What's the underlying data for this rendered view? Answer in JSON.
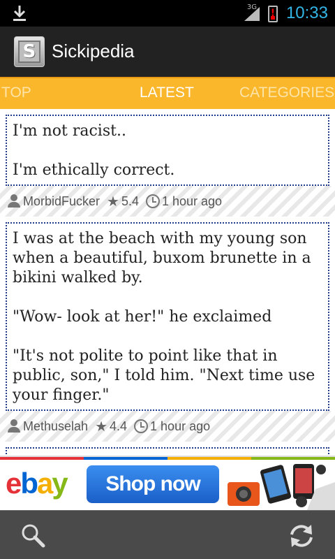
{
  "status_bar": {
    "network": "3G",
    "time": "10:33",
    "battery_alert": "!"
  },
  "app": {
    "title": "Sickipedia",
    "logo_letter": "S"
  },
  "tabs": [
    {
      "label": "TOP",
      "selected": false
    },
    {
      "label": "LATEST",
      "selected": true
    },
    {
      "label": "CATEGORIES",
      "selected": false
    }
  ],
  "posts": [
    {
      "lines": [
        "I'm not racist..",
        "I'm ethically correct."
      ],
      "author": "MorbidFucker",
      "rating": "5.4",
      "time": "1 hour ago"
    },
    {
      "lines": [
        "I was at the beach with my young son when a beautiful, buxom brunette in a bikini walked by.",
        "\"Wow- look at her!\" he exclaimed",
        "\"It's not polite to point like that in public, son,\" I told him. \"Next time use your finger.\""
      ],
      "author": "Methuselah",
      "rating": "4.4",
      "time": "1 hour ago"
    }
  ],
  "ad": {
    "brand_e": "e",
    "brand_b": "b",
    "brand_a": "a",
    "brand_y": "y",
    "button": "Shop now"
  },
  "icons": {
    "download": "download-icon",
    "search": "search-icon",
    "refresh": "refresh-icon"
  },
  "colors": {
    "tab_bar": "#fbb72c",
    "action_bar": "#222222",
    "post_border": "#223a8a",
    "status_accent": "#33b5e5"
  }
}
